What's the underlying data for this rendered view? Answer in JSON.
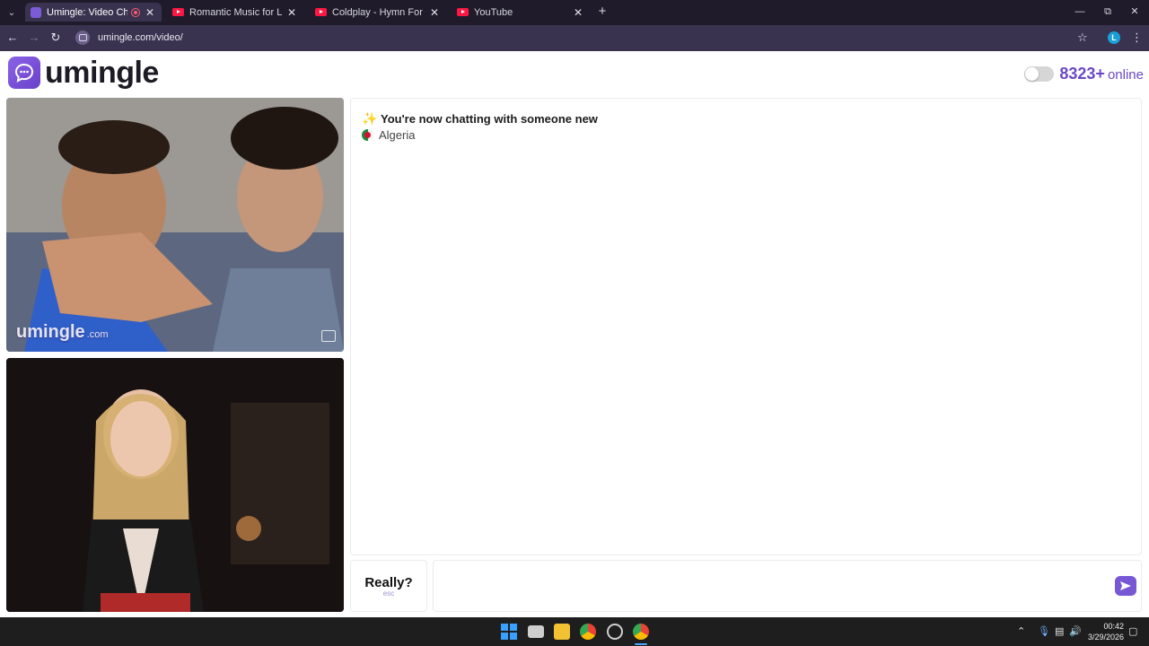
{
  "browser": {
    "tabs": [
      {
        "title": "Umingle: Video Chat with S",
        "active": true
      },
      {
        "title": "Romantic Music for Love Night",
        "active": false
      },
      {
        "title": "Coldplay - Hymn For The Weel",
        "active": false
      },
      {
        "title": "YouTube",
        "active": false
      }
    ],
    "url": "umingle.com/video/",
    "profile_initial": "L"
  },
  "site": {
    "logo_text": "umingle",
    "online_count": "8323+",
    "online_label": "online"
  },
  "stranger_video": {
    "watermark": "umingle",
    "watermark_suffix": ".com"
  },
  "chat": {
    "system_message": "You're now chatting with someone new",
    "country": "Algeria"
  },
  "controls": {
    "skip_label": "Really?",
    "skip_hint": "esc",
    "message_value": ""
  },
  "taskbar": {
    "time": "00:42",
    "date": "3/29/2026"
  },
  "colors": {
    "brand": "#7757d4",
    "tab_bar": "#1f1b2b",
    "toolbar": "#3a3350"
  }
}
